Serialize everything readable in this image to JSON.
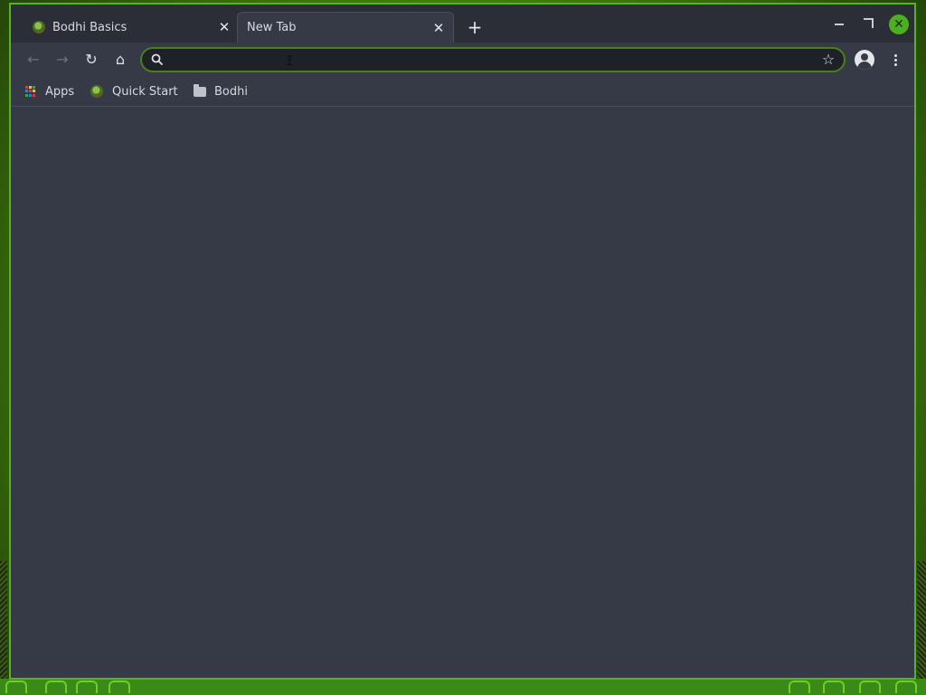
{
  "tabs": [
    {
      "title": "Bodhi Basics",
      "active": false
    },
    {
      "title": "New Tab",
      "active": true
    }
  ],
  "tab_close_glyph": "✕",
  "new_tab_glyph": "+",
  "toolbar": {
    "back_icon": "←",
    "forward_icon": "→",
    "reload_icon": "↻",
    "home_icon": "⌂",
    "star_icon": "☆"
  },
  "omnibox": {
    "value": "",
    "placeholder": ""
  },
  "window_controls": {
    "close_glyph": "✕"
  },
  "bookmarks": [
    {
      "label": "Apps",
      "icon": "apps-grid-icon"
    },
    {
      "label": "Quick Start",
      "icon": "bodhi-favicon"
    },
    {
      "label": "Bodhi",
      "icon": "folder-icon"
    }
  ],
  "colors": {
    "accent": "#57b31e",
    "background": "#363a46",
    "titlebar": "#2b2e37"
  }
}
